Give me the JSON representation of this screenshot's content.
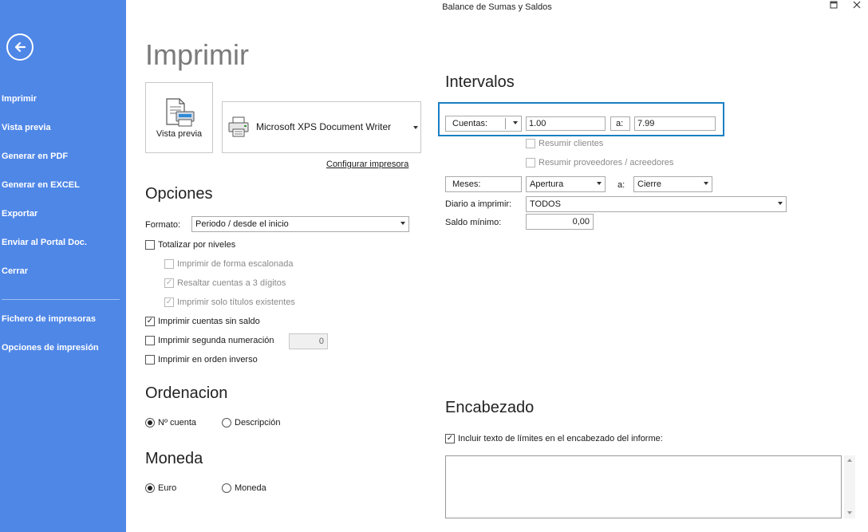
{
  "window": {
    "title": "Balance de Sumas y Saldos",
    "maximize_icon": "maximize-icon",
    "close_icon": "close-icon"
  },
  "sidebar": {
    "back_icon": "arrow-left-icon",
    "items": [
      {
        "label": "Imprimir"
      },
      {
        "label": "Vista previa"
      },
      {
        "label": "Generar en PDF"
      },
      {
        "label": "Generar en EXCEL"
      },
      {
        "label": "Exportar"
      },
      {
        "label": "Enviar al Portal Doc."
      },
      {
        "label": "Cerrar"
      },
      {
        "label": "Fichero de impresoras"
      },
      {
        "label": "Opciones de impresión"
      }
    ]
  },
  "main": {
    "title": "Imprimir",
    "preview_button": {
      "label": "Vista previa",
      "icon": "print-preview-icon"
    },
    "printer": {
      "name": "Microsoft XPS Document Writer",
      "icon": "printer-icon"
    },
    "configure_link": "Configurar impresora"
  },
  "opciones": {
    "heading": "Opciones",
    "formato_label": "Formato:",
    "formato_value": "Periodo / desde el inicio",
    "totalizar": {
      "label": "Totalizar por niveles",
      "checked": false
    },
    "escalonada": {
      "label": "Imprimir de forma escalonada",
      "checked": false
    },
    "resaltar": {
      "label": "Resaltar cuentas a 3 dígitos",
      "checked": true
    },
    "solo_titulos": {
      "label": "Imprimir solo títulos existentes",
      "checked": true
    },
    "sin_saldo": {
      "label": "Imprimir cuentas sin saldo",
      "checked": true
    },
    "segunda_num": {
      "label": "Imprimir segunda numeración",
      "checked": false,
      "value": "0"
    },
    "orden_inverso": {
      "label": "Imprimir en orden inverso",
      "checked": false
    }
  },
  "ordenacion": {
    "heading": "Ordenacion",
    "options": [
      {
        "label": "Nº cuenta",
        "selected": true
      },
      {
        "label": "Descripción",
        "selected": false
      }
    ]
  },
  "moneda": {
    "heading": "Moneda",
    "options": [
      {
        "label": "Euro",
        "selected": true
      },
      {
        "label": "Moneda",
        "selected": false
      }
    ]
  },
  "intervalos": {
    "heading": "Intervalos",
    "cuentas_label": "Cuentas:",
    "cuentas_from": "1.00",
    "a_label": "a:",
    "cuentas_to": "7.99",
    "resumir_clientes": "Resumir clientes",
    "resumir_proveedores": "Resumir proveedores / acreedores",
    "meses_label": "Meses:",
    "meses_from": "Apertura",
    "meses_a_label": "a:",
    "meses_to": "Cierre",
    "diario_label": "Diario a imprimir:",
    "diario_value": "TODOS",
    "saldo_label": "Saldo mínimo:",
    "saldo_value": "0,00"
  },
  "encabezado": {
    "heading": "Encabezado",
    "incluir": {
      "label": "Incluir texto de límites en el encabezado del informe:",
      "checked": true
    },
    "text": ""
  },
  "colors": {
    "sidebar": "#4f87e7",
    "focus_border": "#1a7fc4"
  }
}
